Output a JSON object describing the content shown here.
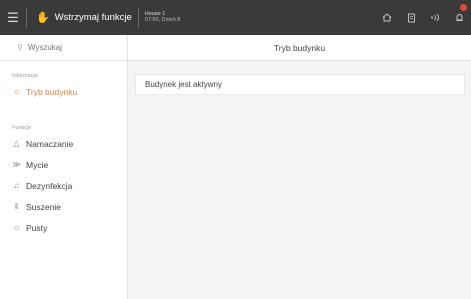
{
  "topbar": {
    "pause_label": "Wstrzymaj funkcje",
    "house_name": "House 1",
    "house_datetime": "07:50, Dzień 8"
  },
  "search": {
    "placeholder": "Wyszukaj"
  },
  "sidebar": {
    "section_info": "Informacja",
    "active_item": "Tryb budynku",
    "section_functions": "Funkcje",
    "items": [
      {
        "label": "Namaczanie",
        "icon": "flask-icon"
      },
      {
        "label": "Mycie",
        "icon": "spray-icon"
      },
      {
        "label": "Dezynfekcja",
        "icon": "disinfect-icon"
      },
      {
        "label": "Suszenie",
        "icon": "dry-icon"
      },
      {
        "label": "Pusty",
        "icon": "house-empty-icon"
      }
    ]
  },
  "main": {
    "title": "Tryb budynku",
    "status": "Budynek jest aktywny"
  },
  "colors": {
    "accent": "#e0803a",
    "topbar": "#3a3a3a",
    "alert": "#e04a3a"
  }
}
